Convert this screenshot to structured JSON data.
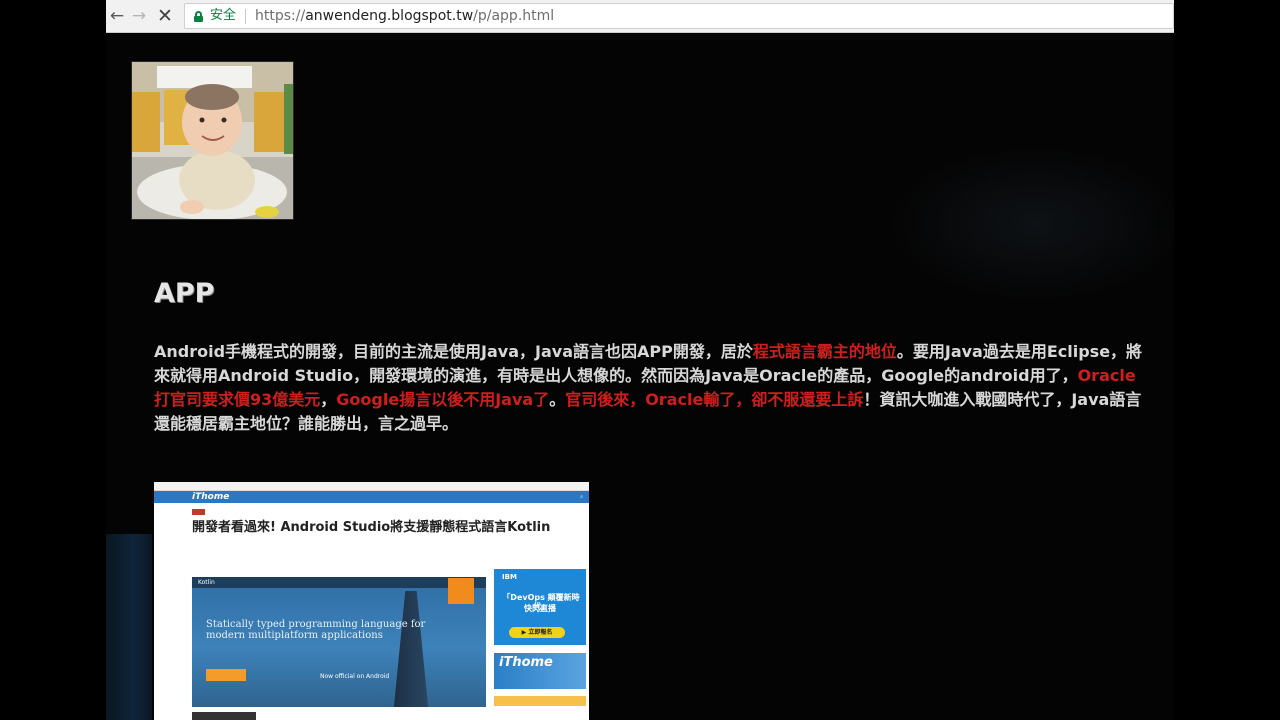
{
  "browser": {
    "secure_label": "安全",
    "url_scheme": "https://",
    "url_host": "anwendeng.blogspot.tw",
    "url_path": "/p/app.html"
  },
  "post": {
    "title": "APP",
    "body_segments": [
      {
        "text": "Android手機程式的開發，目前的主流是使用Java，Java語言也因APP開發，居於",
        "highlight": false
      },
      {
        "text": "程式語言霸主的地位",
        "highlight": true
      },
      {
        "text": "。要用Java過去是用Eclipse，將來就得用Android Studio，開發環境的演進，有時是出人想像的。然而因為Java是Oracle的產品，Google的android用了，",
        "highlight": false
      },
      {
        "text": "Oracle打官司要求價93億美元",
        "highlight": true
      },
      {
        "text": "，",
        "highlight": false
      },
      {
        "text": "Google揚言以後不用Java了",
        "highlight": true
      },
      {
        "text": "。",
        "highlight": false
      },
      {
        "text": "官司後來，Oracle輸了，卻不服還要上訴",
        "highlight": true
      },
      {
        "text": "！資訊大咖進入戰國時代了，Java語言還能穩居霸主地位？誰能勝出，言之過早。",
        "highlight": false
      }
    ]
  },
  "embedded_screenshot": {
    "logo": "iThome",
    "headline": "開發者看過來! Android Studio將支援靜態程式語言Kotlin",
    "hero_brand": "Kotlin",
    "hero_tagline": "Statically typed programming language for modern multiplatform applications",
    "hero_try": "Now official on Android",
    "ad1_brand": "IBM",
    "ad1_line1": "「DevOps 顛覆新時代」",
    "ad1_line2": "快閃直播",
    "ad1_button": "▶ 立即報名",
    "ad2_logo": "iThome"
  },
  "colors": {
    "page_bg": "#040404",
    "text": "#d8d8d8",
    "highlight": "#d01e1e",
    "secure_green": "#0b8043"
  }
}
